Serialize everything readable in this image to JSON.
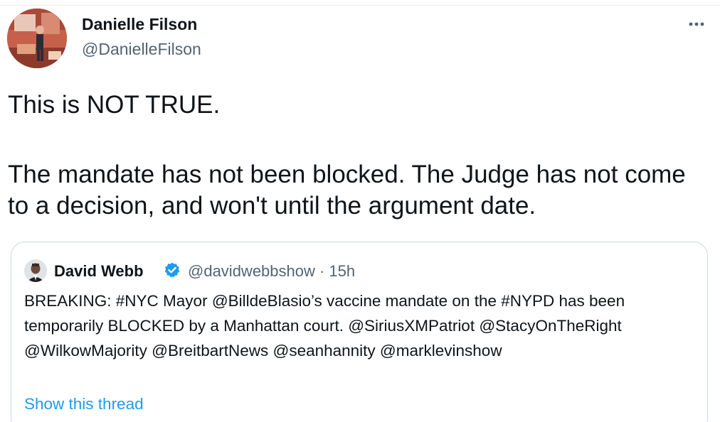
{
  "tweet": {
    "author": {
      "display_name": "Danielle Filson",
      "handle": "@DanielleFilson"
    },
    "more_icon": "more-horizontal-icon",
    "text_lines": [
      "This is NOT TRUE.",
      "The mandate has not been blocked. The Judge has not come to a decision, and won't until the argument date."
    ]
  },
  "quote": {
    "author": {
      "display_name": "David Webb",
      "verified_icon": "verified-badge-icon",
      "handle_time": "@davidwebbshow · 15h"
    },
    "text": "BREAKING: #NYC Mayor @BilldeBlasio’s vaccine mandate on the #NYPD has been temporarily BLOCKED by a Manhattan court. @SiriusXMPatriot @StacyOnTheRight @WilkowMajority @BreitbartNews @seanhannity @marklevinshow",
    "show_thread": "Show this thread"
  },
  "colors": {
    "text_primary": "#0f1419",
    "text_secondary": "#536471",
    "link_blue": "#1d9bf0",
    "border": "#cfd9de"
  }
}
